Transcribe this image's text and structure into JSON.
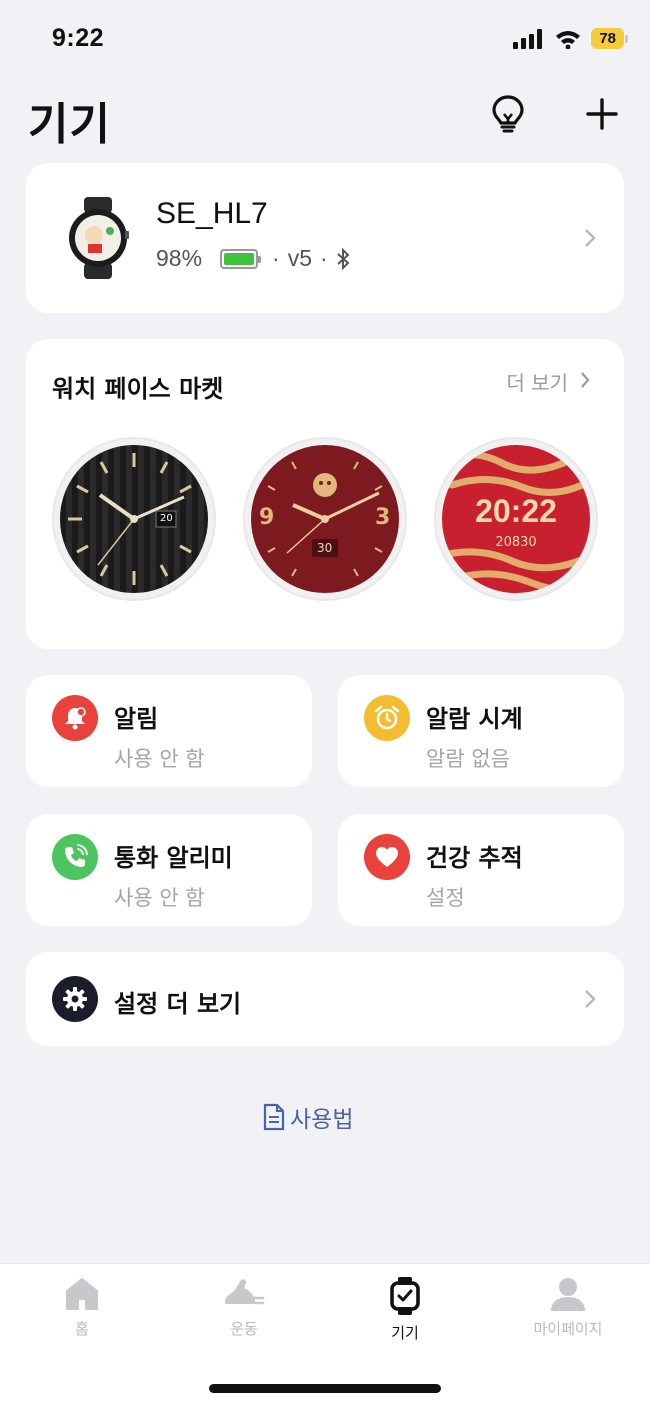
{
  "status": {
    "time": "9:22",
    "battery": "78"
  },
  "header": {
    "title": "기기"
  },
  "device": {
    "name": "SE_HL7",
    "battery_pct": "98%",
    "version": "v5",
    "sep": "·"
  },
  "market": {
    "title": "워치 페이스 마켓",
    "more": "더 보기",
    "faces": [
      {
        "date": "20"
      },
      {
        "n9": "9",
        "n3": "3",
        "date": "30"
      },
      {
        "time": "20:22",
        "steps": "20830"
      }
    ]
  },
  "tiles": [
    {
      "title": "알림",
      "sub": "사용 안 함",
      "color": "#e8423a"
    },
    {
      "title": "알람 시계",
      "sub": "알람 없음",
      "color": "#f4bd2f"
    },
    {
      "title": "통화 알리미",
      "sub": "사용 안 함",
      "color": "#4cc460"
    },
    {
      "title": "건강 추적",
      "sub": "설정",
      "color": "#e8423a"
    }
  ],
  "settings": {
    "label": "설정 더 보기"
  },
  "guide": {
    "label": "사용법"
  },
  "tabs": [
    {
      "label": "홈"
    },
    {
      "label": "운동"
    },
    {
      "label": "기기"
    },
    {
      "label": "마이페이지"
    }
  ]
}
